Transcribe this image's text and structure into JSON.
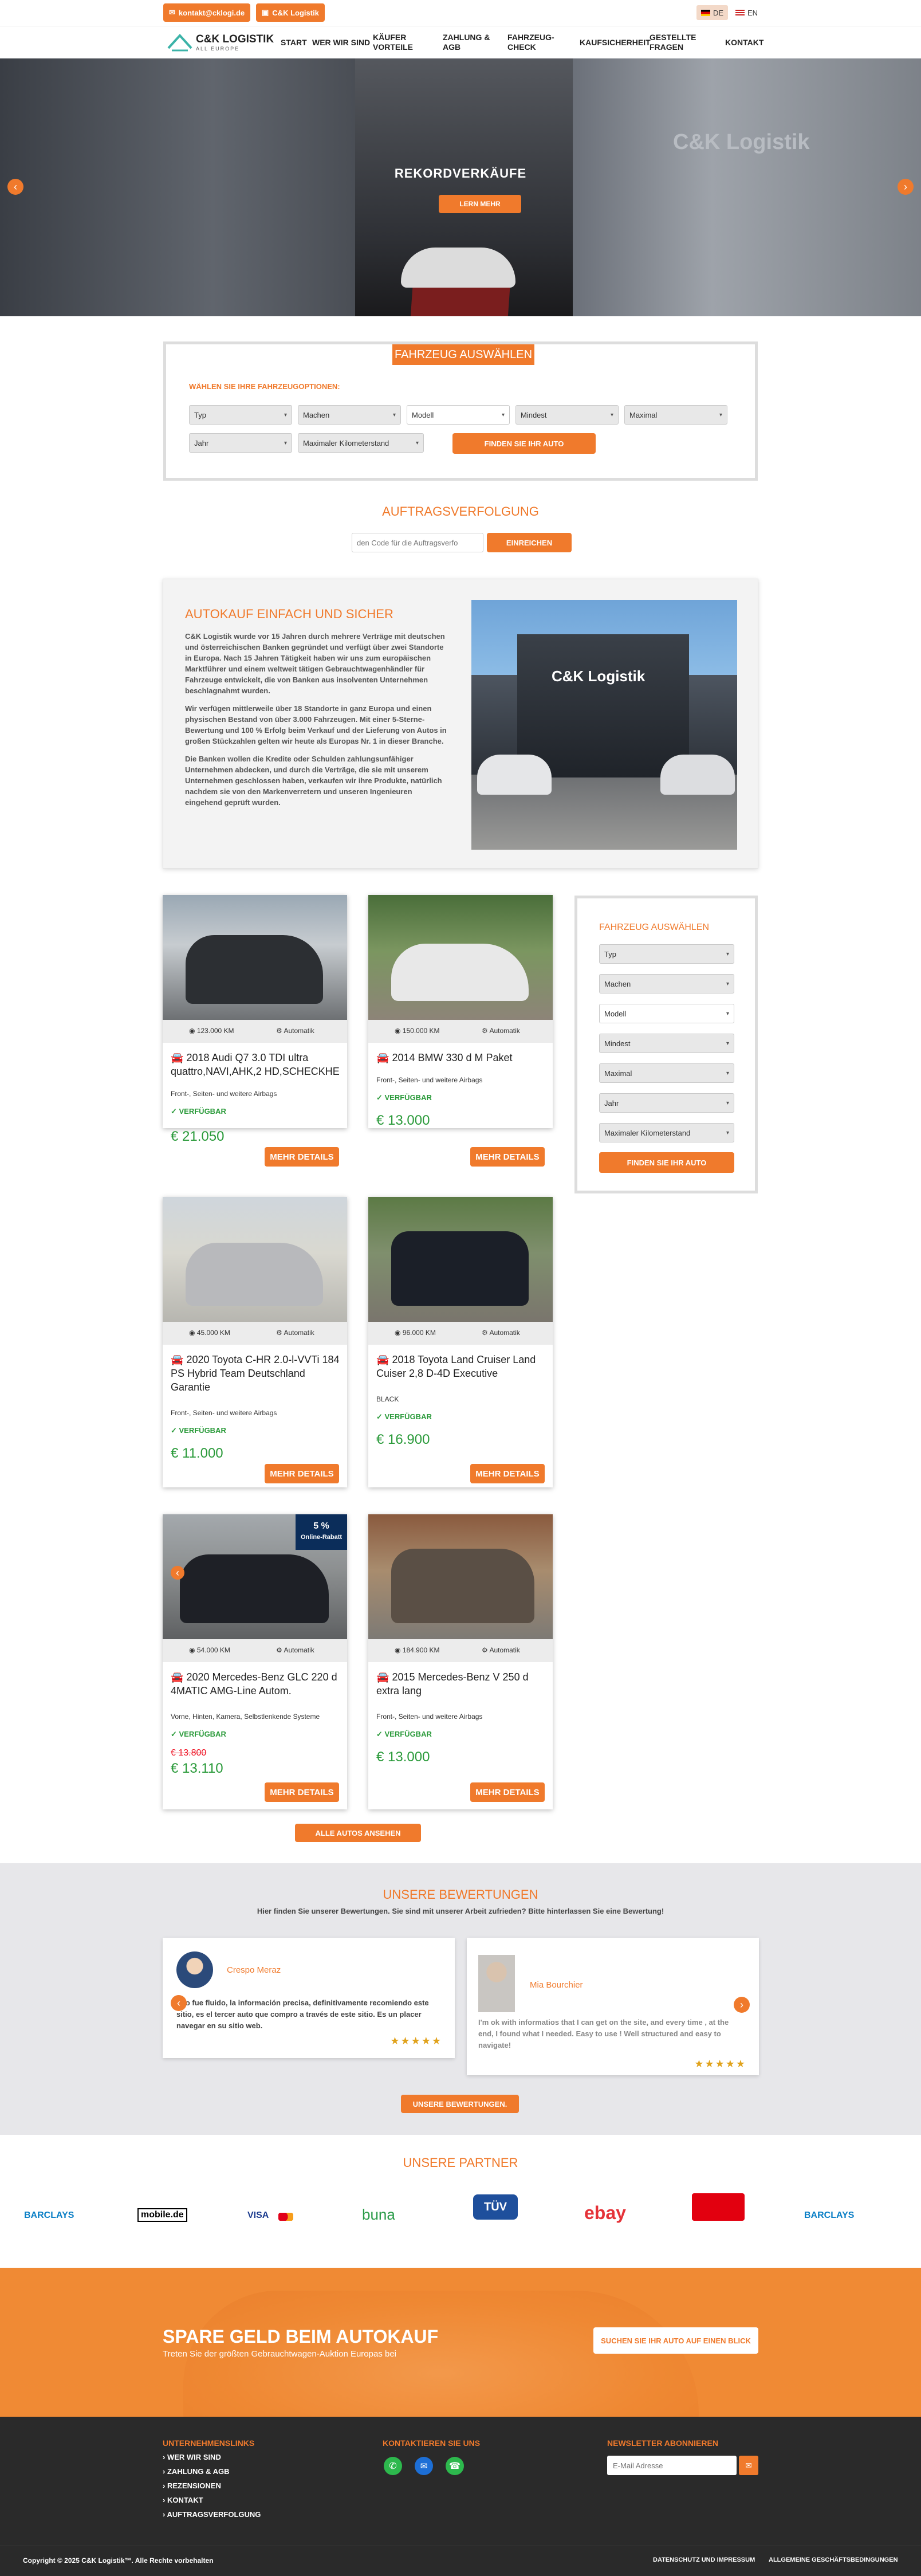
{
  "topbar": {
    "email": "kontakt@cklogi.de",
    "company_chip": "C&K Logistik",
    "lang_de": "DE",
    "lang_en": "EN"
  },
  "nav": {
    "logo_text": "C&K LOGISTIK",
    "logo_sub": "ALL EUROPE",
    "items": [
      {
        "label": "START"
      },
      {
        "label": "WER WIR SIND"
      },
      {
        "label": "KÄUFER VORTEILE"
      },
      {
        "label": "ZAHLUNG & AGB"
      },
      {
        "label": "FAHRZEUG-CHECK"
      },
      {
        "label": "KAUFSICHERHEIT"
      },
      {
        "label": "GESTELLTE FRAGEN"
      },
      {
        "label": "KONTAKT"
      }
    ]
  },
  "hero": {
    "title": "REKORDVERKÄUFE",
    "button": "LERN MEHR",
    "building_sign": "C&K Logistik",
    "prev": "‹",
    "next": "›"
  },
  "search": {
    "title": "FAHRZEUG AUSWÄHLEN",
    "subtitle": "WÄHLEN SIE IHRE FAHRZEUGOPTIONEN:",
    "fields": {
      "typ": "Typ",
      "machen": "Machen",
      "modell": "Modell",
      "mindest": "Mindest",
      "maximal": "Maximal",
      "jahr": "Jahr",
      "km": "Maximaler Kilometerstand"
    },
    "button": "FINDEN SIE IHR AUTO"
  },
  "tracking": {
    "title": "AUFTRAGSVERFOLGUNG",
    "placeholder": "den Code für die Auftragsverfo",
    "button": "EINREICHEN"
  },
  "about": {
    "title": "AUTOKAUF EINFACH UND SICHER",
    "p1": "C&K Logistik wurde vor 15 Jahren durch mehrere Verträge mit deutschen und österreichischen Banken gegründet und verfügt über zwei Standorte in Europa. Nach 15 Jahren Tätigkeit haben wir uns zum europäischen Marktführer und einem weltweit tätigen Gebrauchtwagenhändler für Fahrzeuge entwickelt, die von Banken aus insolventen Unternehmen beschlagnahmt wurden.",
    "p2": "Wir verfügen mittlerweile über 18 Standorte in ganz Europa und einen physischen Bestand von über 3.000 Fahrzeugen. Mit einer 5-Sterne-Bewertung und 100 % Erfolg beim Verkauf und der Lieferung von Autos in großen Stückzahlen gelten wir heute als Europas Nr. 1 in dieser Branche.",
    "p3": "Die Banken wollen die Kredite oder Schulden zahlungsunfähiger Unternehmen abdecken, und durch die Verträge, die sie mit unserem Unternehmen geschlossen haben, verkaufen wir ihre Produkte, natürlich nachdem sie von den Markenverretern und unseren Ingenieuren eingehend geprüft wurden.",
    "building_sign": "C&K Logistik"
  },
  "cars": [
    {
      "km": "123.000 KM",
      "gear": "Automatik",
      "title": "2018 Audi Q7 3.0 TDI ultra quattro,NAVI,AHK,2 HD,SCHECKHE",
      "features": "Front-, Seiten- und weitere Airbags",
      "status": "VERFÜGBAR",
      "price": "€ 21.050",
      "old_price": "",
      "button": "MEHR DETAILS",
      "color": "#2c2f33"
    },
    {
      "km": "150.000 KM",
      "gear": "Automatik",
      "title": "2014 BMW 330 d M Paket",
      "features": "Front-, Seiten- und weitere Airbags",
      "status": "VERFÜGBAR",
      "price": "€ 13.000",
      "old_price": "",
      "button": "MEHR DETAILS",
      "color": "#e8e8e8"
    },
    {
      "km": "45.000 KM",
      "gear": "Automatik",
      "title": "2020 Toyota C-HR 2.0-l-VVTi 184 PS Hybrid Team Deutschland Garantie",
      "features": "Front-, Seiten- und weitere Airbags",
      "status": "VERFÜGBAR",
      "price": "€ 11.000",
      "old_price": "",
      "button": "MEHR DETAILS",
      "color": "#b8b9bc"
    },
    {
      "km": "96.000 KM",
      "gear": "Automatik",
      "title": "2018 Toyota Land Cruiser Land Cuiser 2,8 D-4D Executive",
      "features": "BLACK",
      "status": "VERFÜGBAR",
      "price": "€ 16.900",
      "old_price": "",
      "button": "MEHR DETAILS",
      "color": "#1b1f28"
    },
    {
      "km": "54.000 KM",
      "gear": "Automatik",
      "title": "2020 Mercedes-Benz GLC 220 d 4MATIC AMG-Line Autom.",
      "features": "Vorne, Hinten, Kamera, Selbstlenkende Systeme",
      "status": "VERFÜGBAR",
      "price": "€ 13.110",
      "old_price": "€ 13.800",
      "button": "MEHR DETAILS",
      "color": "#1e2026"
    },
    {
      "km": "184.900 KM",
      "gear": "Automatik",
      "title": "2015 Mercedes-Benz V 250 d extra lang",
      "features": "Front-, Seiten- und weitere Airbags",
      "status": "VERFÜGBAR",
      "price": "€ 13.000",
      "old_price": "",
      "button": "MEHR DETAILS",
      "color": "#5a4f45"
    }
  ],
  "discount_badge": {
    "pct": "5 %",
    "label": "Online-Rabatt"
  },
  "all_cars_button": "ALLE AUTOS ANSEHEN",
  "sidebar": {
    "title": "FAHRZEUG AUSWÄHLEN",
    "fields": [
      "Typ",
      "Machen",
      "Modell",
      "Mindest",
      "Maximal",
      "Jahr",
      "Maximaler Kilometerstand"
    ],
    "button": "FINDEN SIE IHR AUTO"
  },
  "reviews": {
    "title": "UNSERE BEWERTUNGEN",
    "subtitle": "Hier finden Sie unserer Bewertungen. Sie sind mit unserer Arbeit zufrieden? Bitte hinterlassen Sie eine Bewertung!",
    "items": [
      {
        "name": "Crespo Meraz",
        "text": "odo fue fluido, la información precisa, definitivamente recomiendo este sitio, es el tercer auto que compro a través de este sitio. Es un placer navegar en su sitio web.",
        "stars": "★★★★★"
      },
      {
        "name": "Mia Bourchier",
        "text": "I'm ok with informatios that I can get on the site, and every time , at the end, I found what I needed. Easy to use ! Well structured and easy to navigate!",
        "stars": "★★★★★"
      }
    ],
    "button": "UNSERE BEWERTUNGEN."
  },
  "partners": {
    "title": "UNSERE PARTNER",
    "logos": [
      "BARCLAYS",
      "mobile.de",
      "VISA",
      "buna",
      "TÜV",
      "ebay",
      "BARCLAYS"
    ]
  },
  "cta": {
    "title": "SPARE GELD BEIM AUTOKAUF",
    "subtitle": "Treten Sie der größten Gebrauchtwagen-Auktion Europas bei",
    "button": "SUCHEN SIE IHR AUTO AUF EINEN BLICK"
  },
  "footer": {
    "col1_title": "UNTERNEHMENSLINKS",
    "links": [
      "WER WIR SIND",
      "ZAHLUNG & AGB",
      "REZENSIONEN",
      "KONTAKT",
      "AUFTRAGSVERFOLGUNG"
    ],
    "col2_title": "KONTAKTIEREN SIE UNS",
    "col3_title": "NEWSLETTER ABONNIEREN",
    "newsletter_placeholder": "E-Mail Adresse",
    "copyright": "Copyright © 2025 C&K Logistik™. Alle Rechte vorbehalten",
    "legal1": "DATENSCHUTZ UND IMPRESSUM",
    "legal2": "ALLGEMEINE GESCHÄFTSBEDINGUNGEN"
  },
  "colors": {
    "accent": "#f07a2c",
    "available": "#2a9a3a",
    "footer": "#2a2a2a"
  }
}
